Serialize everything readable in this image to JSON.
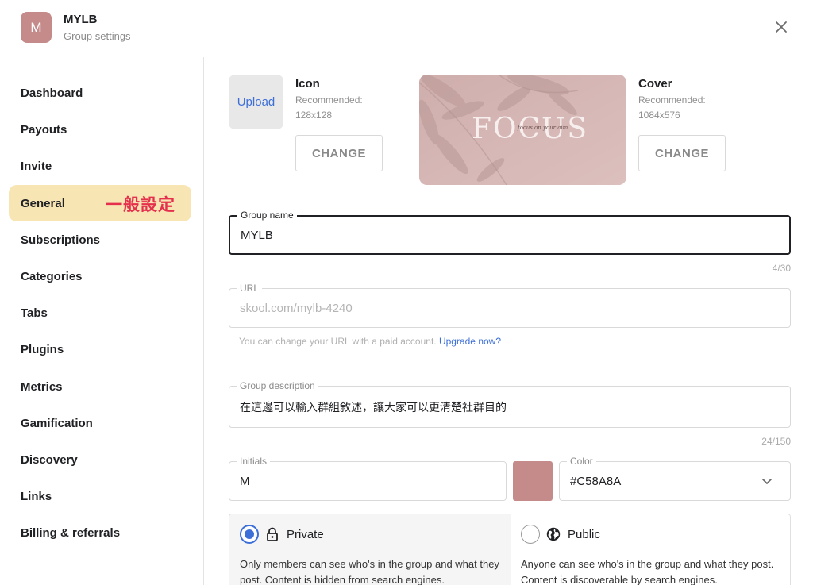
{
  "header": {
    "avatar_initial": "M",
    "title": "MYLB",
    "subtitle": "Group settings"
  },
  "sidebar": {
    "items": [
      {
        "label": "Dashboard"
      },
      {
        "label": "Payouts"
      },
      {
        "label": "Invite"
      },
      {
        "label": "General",
        "active": true
      },
      {
        "label": "Subscriptions"
      },
      {
        "label": "Categories"
      },
      {
        "label": "Tabs"
      },
      {
        "label": "Plugins"
      },
      {
        "label": "Metrics"
      },
      {
        "label": "Gamification"
      },
      {
        "label": "Discovery"
      },
      {
        "label": "Links"
      },
      {
        "label": "Billing & referrals"
      }
    ],
    "annotation": "一般設定"
  },
  "icon_section": {
    "upload_label": "Upload",
    "title": "Icon",
    "rec_label": "Recommended:",
    "rec_size": "128x128",
    "change_label": "CHANGE"
  },
  "cover_section": {
    "image_text": "FOCUS",
    "image_script": "focus on your aim",
    "title": "Cover",
    "rec_label": "Recommended:",
    "rec_size": "1084x576",
    "change_label": "CHANGE"
  },
  "form": {
    "group_name": {
      "label": "Group name",
      "value": "MYLB",
      "counter": "4/30"
    },
    "url": {
      "label": "URL",
      "value": "skool.com/mylb-4240",
      "helper": "You can change your URL with a paid account.",
      "helper_link": "Upgrade now?"
    },
    "description": {
      "label": "Group description",
      "value": "在這邊可以輸入群組敘述，讓大家可以更清楚社群目的",
      "counter": "24/150"
    },
    "initials": {
      "label": "Initials",
      "value": "M"
    },
    "color": {
      "label": "Color",
      "value": "#C58A8A",
      "swatch": "#C58A8A"
    }
  },
  "privacy": {
    "private": {
      "label": "Private",
      "desc": "Only members can see who's in the group and what they post. Content is hidden from search engines.",
      "selected": true
    },
    "public": {
      "label": "Public",
      "desc": "Anyone can see who's in the group and what they post. Content is discoverable by search engines.",
      "selected": false
    }
  },
  "colors": {
    "accent": "#3d6fd9",
    "active_nav": "#F8E5B4",
    "annotation": "#E5304D",
    "brand": "#C58A8A"
  }
}
